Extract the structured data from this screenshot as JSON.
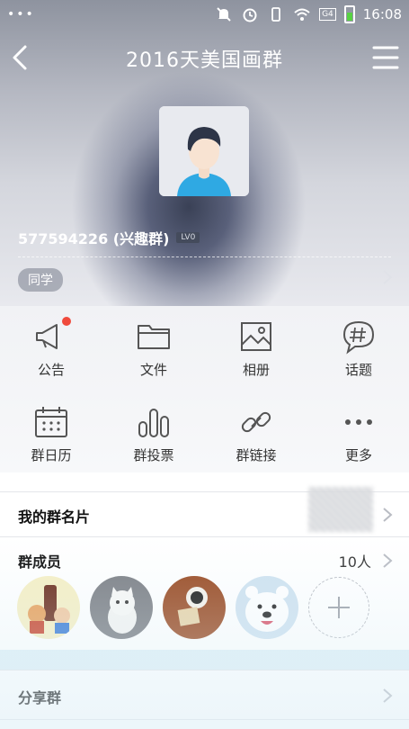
{
  "status_bar": {
    "time": "16:08",
    "signal": "G4"
  },
  "header": {
    "title": "2016天美国画群"
  },
  "group": {
    "name": "577594226 (兴趣群)",
    "level": "LV0",
    "tag": "同学"
  },
  "features": [
    {
      "label": "公告",
      "icon": "megaphone-icon"
    },
    {
      "label": "文件",
      "icon": "folder-icon"
    },
    {
      "label": "相册",
      "icon": "image-icon"
    },
    {
      "label": "话题",
      "icon": "hashtag-icon"
    },
    {
      "label": "群日历",
      "icon": "calendar-icon"
    },
    {
      "label": "群投票",
      "icon": "chart-icon"
    },
    {
      "label": "群链接",
      "icon": "link-icon"
    },
    {
      "label": "更多",
      "icon": "more-icon"
    }
  ],
  "my_card": {
    "label": "我的群名片"
  },
  "members": {
    "label": "群成员",
    "count": "10人"
  },
  "share": {
    "label": "分享群"
  },
  "colors": {
    "notification_dot": "#f04a3c",
    "avatar_shirt": "#2fa9e3"
  }
}
